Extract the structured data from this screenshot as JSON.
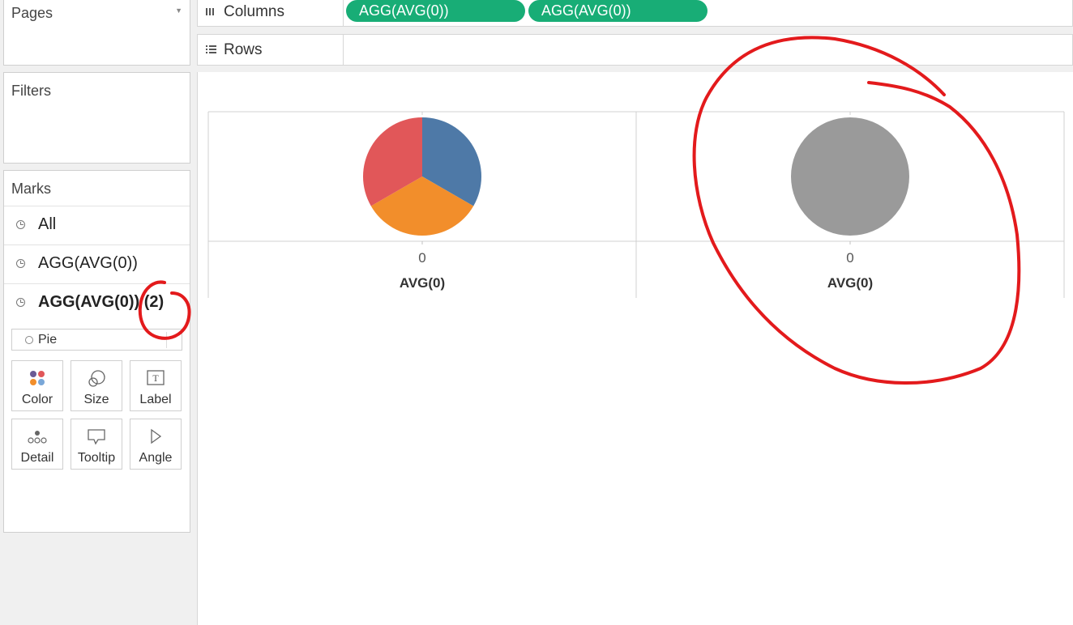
{
  "cards": {
    "pages_title": "Pages",
    "filters_title": "Filters",
    "marks_title": "Marks"
  },
  "marks": {
    "rows": [
      {
        "label": "All",
        "bold": false
      },
      {
        "label": "AGG(AVG(0))",
        "bold": false
      },
      {
        "label": "AGG(AVG(0)) (2)",
        "bold": true
      }
    ],
    "mark_type": "Pie",
    "buttons": [
      "Color",
      "Size",
      "Label",
      "Detail",
      "Tooltip",
      "Angle"
    ]
  },
  "shelves": {
    "columns_label": "Columns",
    "rows_label": "Rows",
    "column_pills": [
      "AGG(AVG(0))",
      "AGG(AVG(0))"
    ]
  },
  "view": {
    "panes": [
      {
        "axis_value": "0",
        "axis_label": "AVG(0)"
      },
      {
        "axis_value": "0",
        "axis_label": "AVG(0)"
      }
    ]
  },
  "colors": {
    "pill": "#18ad76",
    "pie_blue": "#4e79a7",
    "pie_orange": "#f28e2b",
    "pie_red": "#e15759",
    "pie_gray": "#9a9a9a",
    "annotation_red": "#e31a1c"
  },
  "chart_data": [
    {
      "type": "pie",
      "slices": [
        {
          "color": "#4e79a7",
          "value": 1
        },
        {
          "color": "#f28e2b",
          "value": 1
        },
        {
          "color": "#e15759",
          "value": 1
        }
      ]
    },
    {
      "type": "pie",
      "slices": [
        {
          "color": "#9a9a9a",
          "value": 1
        }
      ]
    }
  ]
}
